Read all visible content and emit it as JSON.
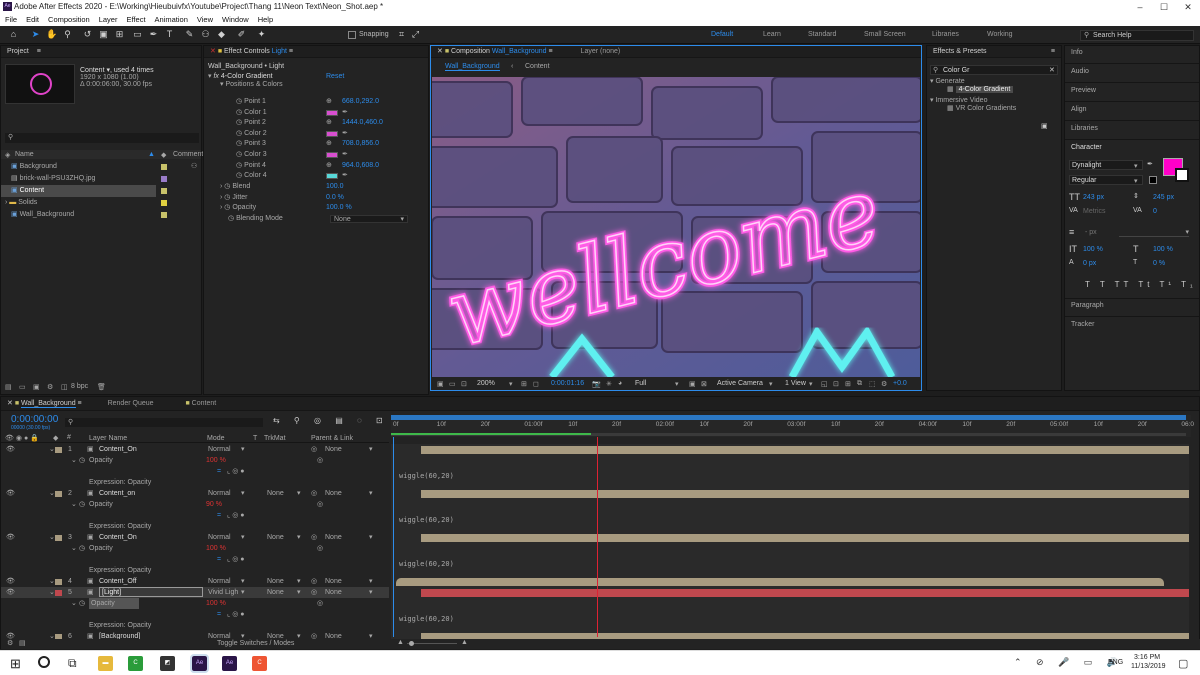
{
  "window": {
    "title": "Adobe After Effects 2020 - E:\\Working\\Hieubuivfx\\Youtube\\Project\\Thang 11\\Neon Text\\Neon_Shot.aep *"
  },
  "menu": [
    "File",
    "Edit",
    "Composition",
    "Layer",
    "Effect",
    "Animation",
    "View",
    "Window",
    "Help"
  ],
  "toolbar": {
    "snapping": "Snapping",
    "workspaces": [
      "Default",
      "Learn",
      "Standard",
      "Small Screen",
      "Libraries",
      "Working"
    ],
    "active_workspace": "Default",
    "search_placeholder": "Search Help"
  },
  "project": {
    "tab": "Project",
    "selected_name": "Content",
    "used": ", used 4 times",
    "dims": "1920 x 1080 (1.00)",
    "duration": "Δ 0:00:06:00, 30.00 fps",
    "col_name": "Name",
    "col_comment": "Comment",
    "items": [
      "Background",
      "brick-wall-PSU3ZHQ.jpg",
      "Content",
      "Solids",
      "Wall_Background"
    ],
    "bpc": "8 bpc"
  },
  "effect_controls": {
    "tab_prefix": "Effect Controls",
    "tab_layer": "Light",
    "header": "Wall_Background • Light",
    "effect": "4-Color Gradient",
    "reset": "Reset",
    "group": "Positions & Colors",
    "props": [
      {
        "name": "Point 1",
        "value": "668.0,292.0"
      },
      {
        "name": "Color 1",
        "swatch": "#d84fd0"
      },
      {
        "name": "Point 2",
        "value": "1444.0,460.0"
      },
      {
        "name": "Color 2",
        "swatch": "#d84fd0"
      },
      {
        "name": "Point 3",
        "value": "708.0,856.0"
      },
      {
        "name": "Color 3",
        "swatch": "#d84fd0"
      },
      {
        "name": "Point 4",
        "value": "964.0,608.0"
      },
      {
        "name": "Color 4",
        "swatch": "#58d8d8"
      }
    ],
    "blend_label": "Blend",
    "blend": "100.0",
    "jitter_label": "Jitter",
    "jitter": "0.0 %",
    "opacity_label": "Opacity",
    "opacity": "100.0 %",
    "mode_label": "Blending Mode",
    "mode": "None"
  },
  "composition": {
    "tab_prefix": "Composition",
    "tab_name": "Wall_Background",
    "layer_tab": "Layer (none)",
    "crumb1": "Wall_Background",
    "crumb2": "Content",
    "text": "wellcome",
    "zoom": "200%",
    "time": "0:00:01:16",
    "quality": "Full",
    "camera": "Active Camera",
    "views": "1 View",
    "offset": "+0.0"
  },
  "effects_presets": {
    "title": "Effects & Presets",
    "search": "Color Gr",
    "cat1": "Generate",
    "item1": "4-Color Gradient",
    "cat2": "Immersive Video",
    "item2": "VR Color Gradients"
  },
  "right_panels": [
    "Info",
    "Audio",
    "Preview",
    "Align",
    "Libraries"
  ],
  "character": {
    "title": "Character",
    "font": "Dynalight",
    "style": "Regular",
    "size": "243 px",
    "leading": "245 px",
    "kerning": "Metrics",
    "tracking": "0",
    "stroke": "- px",
    "vscale": "100 %",
    "hscale": "100 %",
    "baseline": "0 px",
    "tsume": "0 %",
    "fill_color": "#ff00c8",
    "paragraph": "Paragraph",
    "tracker": "Tracker"
  },
  "timeline": {
    "tab": "Wall_Background",
    "render_queue": "Render Queue",
    "content_tab": "Content",
    "timecode": "0:00:00:00",
    "timecode_sub": "00000 (30.00 fps)",
    "cols": [
      "Layer Name",
      "Mode",
      "T",
      "TrkMat",
      "Parent & Link"
    ],
    "ruler": [
      "0f",
      "10f",
      "20f",
      "01:00f",
      "10f",
      "20f",
      "02:00f",
      "10f",
      "20f",
      "03:00f",
      "10f",
      "20f",
      "04:00f",
      "10f",
      "20f",
      "05:00f",
      "10f",
      "20f",
      "06:0"
    ],
    "layers": [
      {
        "num": "1",
        "name": "Content_On",
        "mode": "Normal",
        "trk": "",
        "parent": "None",
        "opacity": "100 %",
        "expr": "Expression: Opacity",
        "code": "wiggle(60,20)",
        "color": "#a89b80"
      },
      {
        "num": "2",
        "name": "Content_on",
        "mode": "Normal",
        "trk": "None",
        "parent": "None",
        "opacity": "90 %",
        "expr": "Expression: Opacity",
        "code": "wiggle(60,20)",
        "color": "#a89b80"
      },
      {
        "num": "3",
        "name": "Content_On",
        "mode": "Normal",
        "trk": "None",
        "parent": "None",
        "opacity": "100 %",
        "expr": "Expression: Opacity",
        "code": "wiggle(60,20)",
        "color": "#a89b80"
      },
      {
        "num": "4",
        "name": "Content_Off",
        "mode": "Normal",
        "trk": "None",
        "parent": "None",
        "color": "#a89b80"
      },
      {
        "num": "5",
        "name": "[Light]",
        "mode": "Vivid Ligh",
        "trk": "None",
        "parent": "None",
        "opacity": "100 %",
        "expr": "Expression: Opacity",
        "code": "wiggle(60,20)",
        "color": "#c0484e"
      },
      {
        "num": "6",
        "name": "[Background]",
        "mode": "Normal",
        "trk": "None",
        "parent": "None",
        "color": "#a89b80"
      }
    ],
    "toggle": "Toggle Switches / Modes",
    "opacity_label": "Opacity"
  },
  "taskbar": {
    "time": "3:16 PM",
    "date": "11/13/2019",
    "lang": "ENG"
  }
}
